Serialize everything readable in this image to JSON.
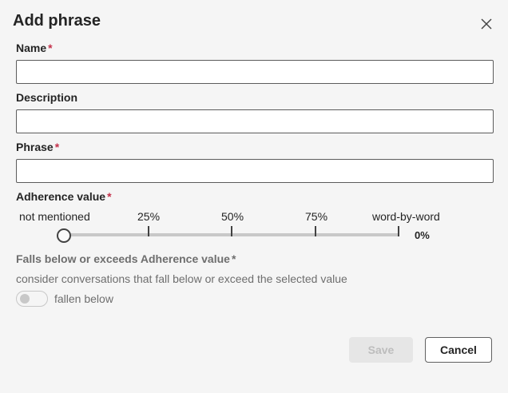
{
  "dialog": {
    "title": "Add phrase",
    "close_icon": "close-icon"
  },
  "form": {
    "name": {
      "label": "Name",
      "required_mark": "*",
      "value": ""
    },
    "description": {
      "label": "Description",
      "value": ""
    },
    "phrase": {
      "label": "Phrase",
      "required_mark": "*",
      "value": ""
    }
  },
  "adherence": {
    "label": "Adherence value",
    "required_mark": "*",
    "ticks": [
      "not mentioned",
      "25%",
      "50%",
      "75%",
      "word-by-word"
    ],
    "current_value": "0%",
    "level_fraction": 0
  },
  "threshold": {
    "label": "Falls below or exceeds Adherence value",
    "required_mark": "*",
    "description": "consider conversations that fall below or exceed the selected value",
    "toggle_label": "fallen below",
    "toggle_on": false
  },
  "footer": {
    "save_label": "Save",
    "save_disabled": true,
    "cancel_label": "Cancel"
  },
  "colors": {
    "background": "#f5f5f5",
    "required": "#c4314b",
    "text": "#242424",
    "muted": "#6e6e6e"
  }
}
